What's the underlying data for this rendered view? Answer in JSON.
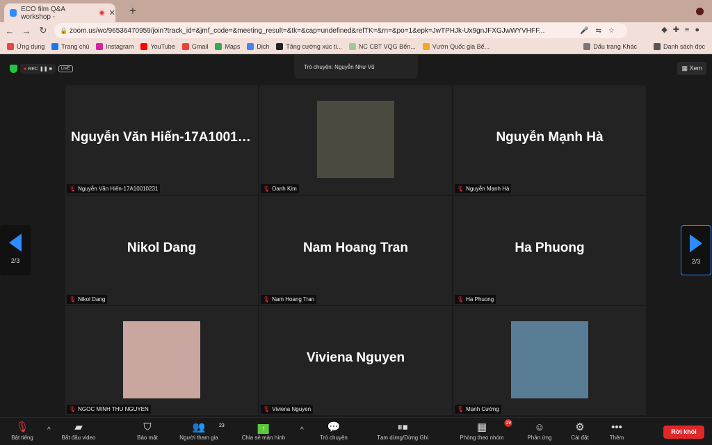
{
  "browser": {
    "tab_title": "ECO film Q&A workshop -",
    "url": "zoom.us/wc/96536470959/join?track_id=&jmf_code=&meeting_result=&tk=&cap=undefined&refTK=&rn=&po=1&epk=JwTPHJk-Ux9gnJFXGJwWYVHFF...",
    "bookmarks": [
      {
        "label": "Ứng dụng",
        "color": "#e44"
      },
      {
        "label": "Trang chủ",
        "color": "#1877f2"
      },
      {
        "label": "Instagram",
        "color": "#d6249f"
      },
      {
        "label": "YouTube",
        "color": "#f00"
      },
      {
        "label": "Gmail",
        "color": "#ea4335"
      },
      {
        "label": "Maps",
        "color": "#34a853"
      },
      {
        "label": "Dịch",
        "color": "#4285f4"
      },
      {
        "label": "Tăng cường xúc ti...",
        "color": "#222"
      },
      {
        "label": "NC CBT VQG Bến...",
        "color": "#9c9"
      },
      {
        "label": "Vườn Quốc gia Bế...",
        "color": "#f5a623"
      }
    ],
    "bookmarks_right": [
      "Dấu trang Khác",
      "Danh sách đọc"
    ]
  },
  "meeting": {
    "rec_label": "REC",
    "live_label": "LIVE",
    "chat_popup": "Trò chuyện: Nguyễn Như Vũ",
    "view_label": "Xem",
    "page_left": "2/3",
    "page_right": "2/3",
    "tiles": [
      {
        "display": "Nguyễn Văn Hiến-17A10010...",
        "name": "Nguyễn Văn Hiến-17A10010231",
        "photo": null
      },
      {
        "display": "",
        "name": "Oanh Kim",
        "photo": "#4a4a3e"
      },
      {
        "display": "Nguyễn Mạnh Hà",
        "name": "Nguyễn Mạnh Hà",
        "photo": null
      },
      {
        "display": "Nikol Dang",
        "name": "Nikol Dang",
        "photo": null
      },
      {
        "display": "Nam Hoang Tran",
        "name": "Nam Hoang Tran",
        "photo": null
      },
      {
        "display": "Ha Phuong",
        "name": "Ha Phuong",
        "photo": null
      },
      {
        "display": "",
        "name": "NGOC MINH THU NGUYEN",
        "photo": "#c9a7a0"
      },
      {
        "display": "Viviena Nguyen",
        "name": "Viviena Nguyen",
        "photo": null
      },
      {
        "display": "",
        "name": "Mạnh Cường",
        "photo": "#5a7d96"
      }
    ]
  },
  "controls": {
    "unmute": "Bật tiếng",
    "start_video": "Bắt đầu video",
    "security": "Bảo mật",
    "participants": "Người tham gia",
    "participants_count": "23",
    "share": "Chia sẻ màn hình",
    "chat": "Trò chuyện",
    "record": "Tạm dừng/Dừng Ghi",
    "breakout": "Phòng theo nhóm",
    "breakout_count": "19",
    "reactions": "Phản ứng",
    "settings": "Cài đặt",
    "more": "Thêm",
    "leave": "Rời khỏi"
  }
}
